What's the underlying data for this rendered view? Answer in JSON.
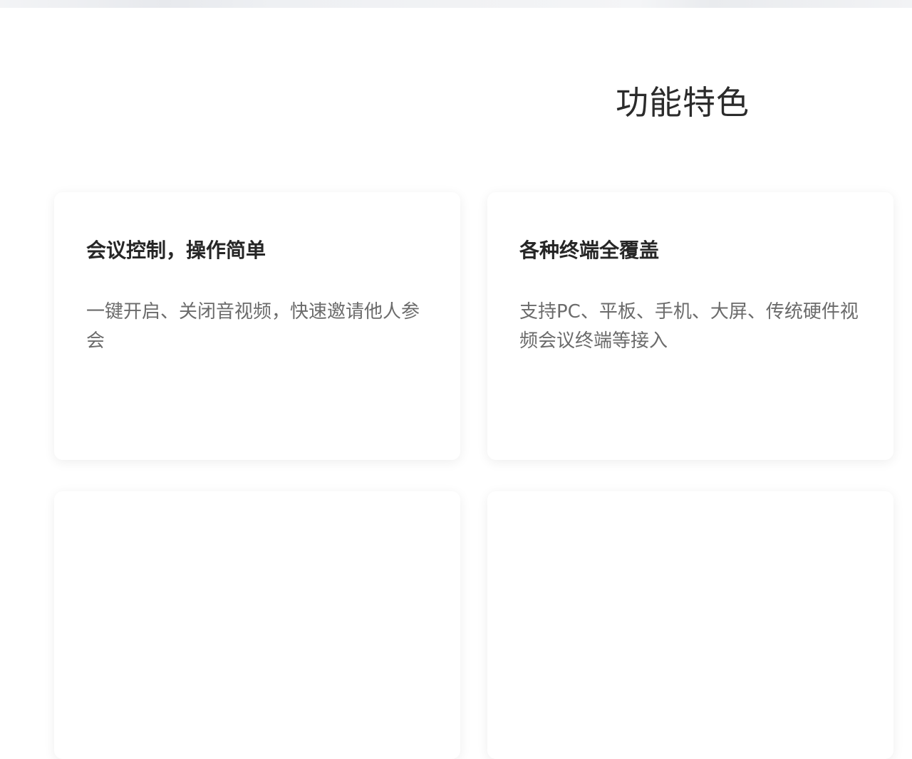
{
  "section": {
    "title": "功能特色"
  },
  "features": [
    {
      "title": "会议控制，操作简单",
      "description": "一键开启、关闭音视频，快速邀请他人参会"
    },
    {
      "title": "各种终端全覆盖",
      "description": "支持PC、平板、手机、大屏、传统硬件视频会议终端等接入"
    }
  ]
}
